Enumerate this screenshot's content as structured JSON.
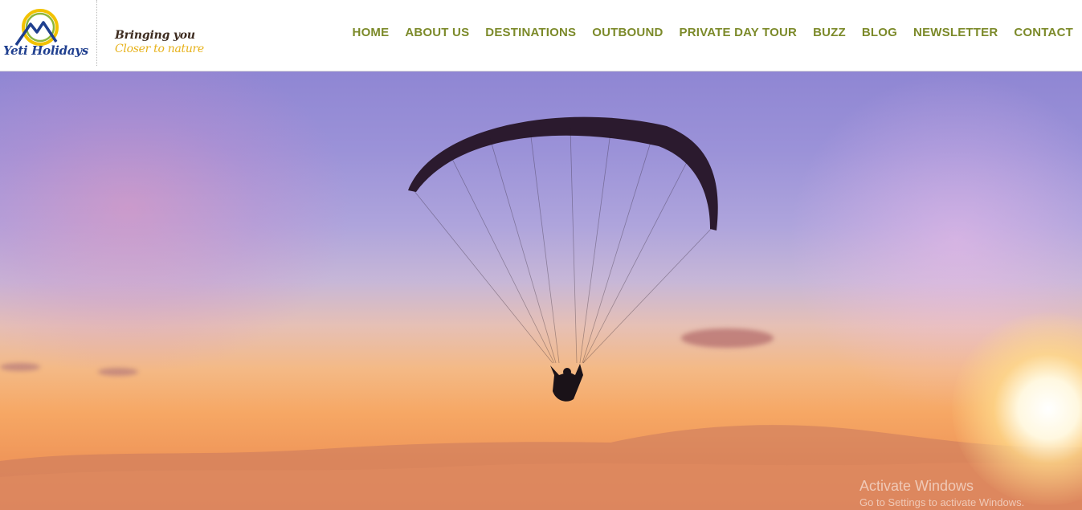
{
  "brand": {
    "name": "Yeti Holidays",
    "tagline_line1": "Bringing you",
    "tagline_line2": "Closer to nature",
    "colors": {
      "blue": "#1f3f8f",
      "sun": "#f2c200",
      "green": "#8cb63c",
      "nav": "#7c8a2a"
    }
  },
  "nav": {
    "items": [
      {
        "label": "HOME"
      },
      {
        "label": "ABOUT US"
      },
      {
        "label": "DESTINATIONS"
      },
      {
        "label": "OUTBOUND"
      },
      {
        "label": "PRIVATE DAY TOUR"
      },
      {
        "label": "BUZZ"
      },
      {
        "label": "BLOG"
      },
      {
        "label": "NEWSLETTER"
      },
      {
        "label": "CONTACT"
      }
    ]
  },
  "hero": {
    "subject": "paraglider",
    "icons": [
      "paraglider-icon",
      "sun-icon"
    ]
  },
  "os_overlay": {
    "title": "Activate Windows",
    "subtitle": "Go to Settings to activate Windows."
  }
}
